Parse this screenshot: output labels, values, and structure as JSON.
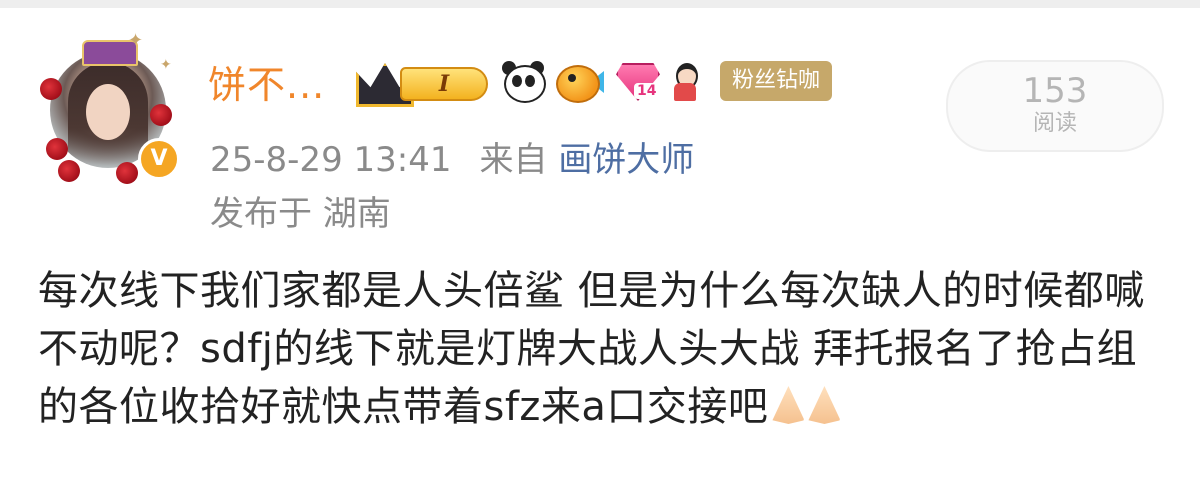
{
  "profile": {
    "username": "饼不...",
    "verified_mark": "V",
    "vip_level": "I",
    "gem_level": "14",
    "fan_badge": "粉丝钻咖",
    "badge_icons": [
      "vip-crown-icon",
      "panda-icon",
      "fish-icon",
      "gem-icon",
      "doll-icon"
    ]
  },
  "post": {
    "date": "25-8-29 13:41",
    "source_prefix": "来自",
    "source": "画饼大师",
    "location": "发布于 湖南",
    "text": "每次线下我们家都是人头倍鲨 但是为什么每次缺人的时候都喊不动呢？sdfj的线下就是灯牌大战人头大战 拜托报名了抢占组的各位收拾好就快点带着sfz来a口交接吧"
  },
  "stats": {
    "read_count": "153",
    "read_label": "阅读"
  },
  "colors": {
    "username": "#f0862b",
    "meta_gray": "#8a8a8a",
    "link_blue": "#4e6ea3",
    "fan_badge_bg": "#c6a86a"
  }
}
